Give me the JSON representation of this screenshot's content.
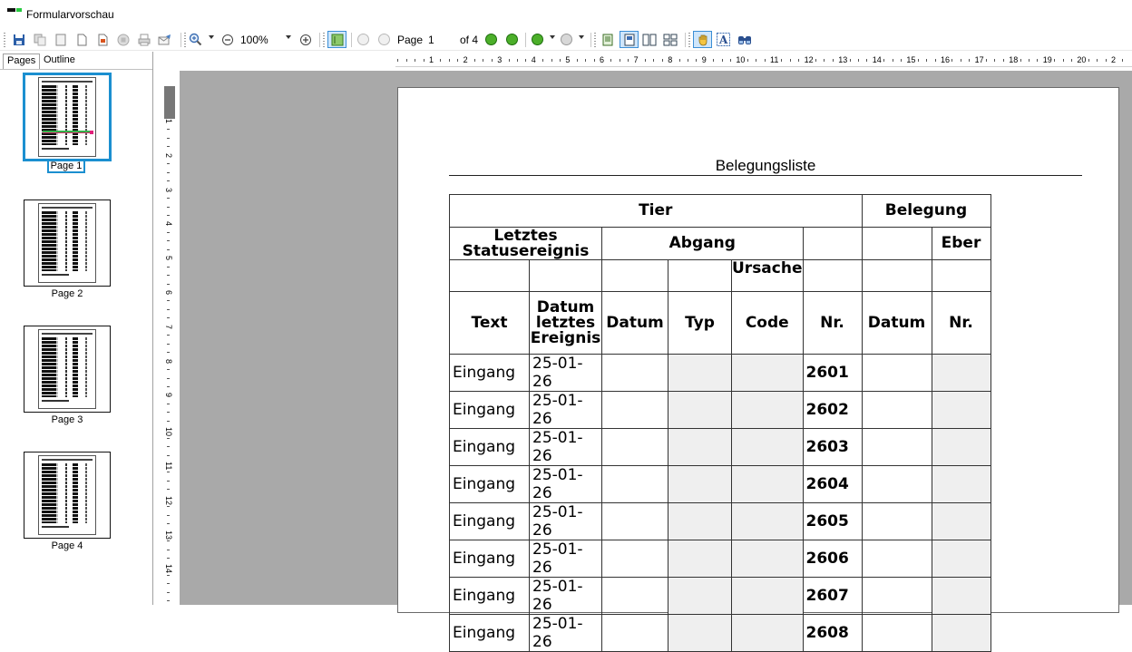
{
  "window": {
    "title": "Formularvorschau"
  },
  "toolbar": {
    "zoom": "100%",
    "page_label": "Page",
    "page_value": "1",
    "of_label": "of 4"
  },
  "left_panel": {
    "tabs": [
      "Pages",
      "Outline"
    ],
    "thumbnails": [
      {
        "label": "Page 1",
        "active": true
      },
      {
        "label": "Page 2",
        "active": false
      },
      {
        "label": "Page 3",
        "active": false
      },
      {
        "label": "Page 4",
        "active": false
      }
    ]
  },
  "ruler": {
    "h_numbers": [
      "1",
      "2",
      "3",
      "4",
      "5",
      "6",
      "7",
      "8",
      "9",
      "10",
      "11",
      "12",
      "13",
      "14",
      "15",
      "16",
      "17",
      "18",
      "19",
      "20",
      "2"
    ],
    "v_numbers": [
      "1",
      "2",
      "3",
      "4",
      "5",
      "6",
      "7",
      "8",
      "9",
      "10",
      "11",
      "12",
      "13",
      "14",
      "15"
    ]
  },
  "report": {
    "title": "Belegungsliste",
    "header": {
      "group_tier": "Tier",
      "group_belegung": "Belegung",
      "letztes_statusereignis": "Letztes Statusereignis",
      "abgang": "Abgang",
      "eber": "Eber",
      "ursache": "Ursache",
      "columns": [
        "Text",
        "Datum letztes Ereignis",
        "Datum",
        "Typ",
        "Code",
        "Nr.",
        "Datum",
        "Nr."
      ]
    },
    "rows": [
      {
        "text": "Eingang",
        "date": "25-01-26",
        "nr": "2601"
      },
      {
        "text": "Eingang",
        "date": "25-01-26",
        "nr": "2602"
      },
      {
        "text": "Eingang",
        "date": "25-01-26",
        "nr": "2603"
      },
      {
        "text": "Eingang",
        "date": "25-01-26",
        "nr": "2604"
      },
      {
        "text": "Eingang",
        "date": "25-01-26",
        "nr": "2605"
      },
      {
        "text": "Eingang",
        "date": "25-01-26",
        "nr": "2606"
      },
      {
        "text": "Eingang",
        "date": "25-01-26",
        "nr": "2607"
      },
      {
        "text": "Eingang",
        "date": "25-01-26",
        "nr": "2608"
      }
    ]
  }
}
